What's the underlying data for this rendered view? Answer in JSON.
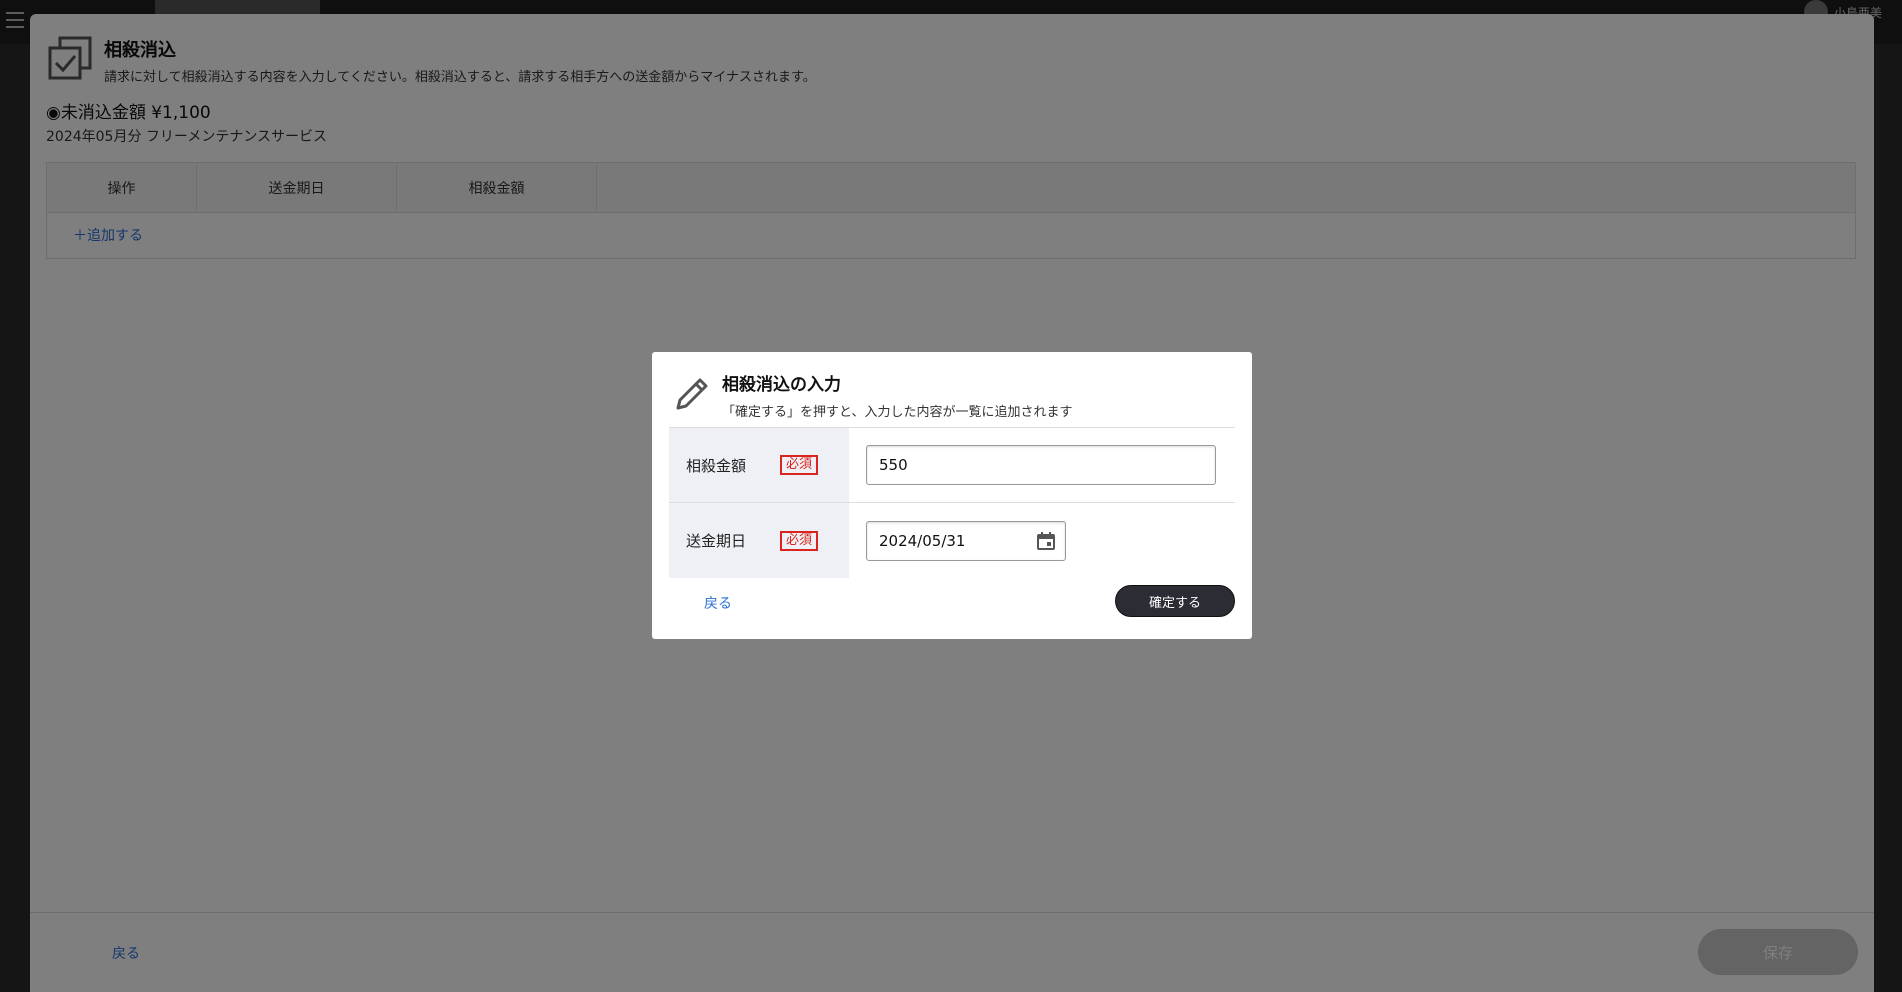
{
  "app": {
    "user_name": "小島亜美"
  },
  "panel": {
    "title": "相殺消込",
    "description": "請求に対して相殺消込する内容を入力してください。相殺消込すると、請求する相手方への送金額からマイナスされます。",
    "balance_label": "◉未消込金額 ¥1,100",
    "invoice_label": "2024年05月分 フリーメンテナンスサービス",
    "table": {
      "headers": [
        "操作",
        "送金期日",
        "相殺金額"
      ],
      "add_label": "＋追加する"
    },
    "footer": {
      "back_label": "戻る",
      "save_label": "保存"
    }
  },
  "modal": {
    "title": "相殺消込の入力",
    "description": "「確定する」を押すと、入力した内容が一覧に追加されます",
    "fields": [
      {
        "label": "相殺金額",
        "required": "必須",
        "value": "550"
      },
      {
        "label": "送金期日",
        "required": "必須",
        "value": "2024/05/31"
      }
    ],
    "back_label": "戻る",
    "confirm_label": "確定する"
  },
  "colors": {
    "link": "#2a6fd6",
    "required": "#d9251d",
    "confirm_button": "#2c2c34",
    "label_bg": "#eef0f5"
  }
}
